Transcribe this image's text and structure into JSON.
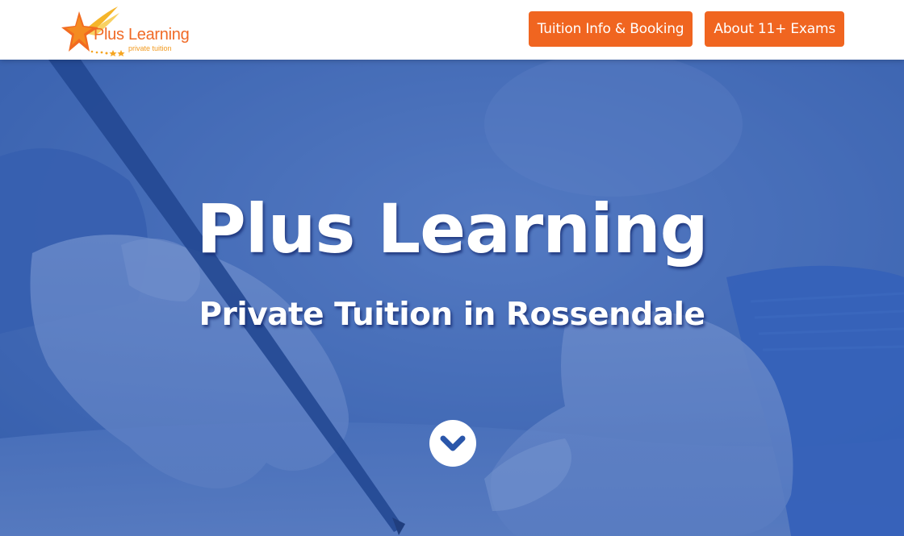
{
  "brand": {
    "name": "Plus Learning",
    "tagline": "private tuition",
    "logo_icon": "star-icon",
    "colors": {
      "orange": "#f06520",
      "gold": "#f5a623",
      "hero_blue": "#2a56aa",
      "white": "#ffffff"
    }
  },
  "nav": {
    "items": [
      {
        "label": "Tuition Info & Booking"
      },
      {
        "label": "About 11+ Exams"
      }
    ]
  },
  "hero": {
    "title": "Plus Learning",
    "subtitle": "Private Tuition in Rossendale",
    "scroll_icon": "chevron-down-icon"
  }
}
